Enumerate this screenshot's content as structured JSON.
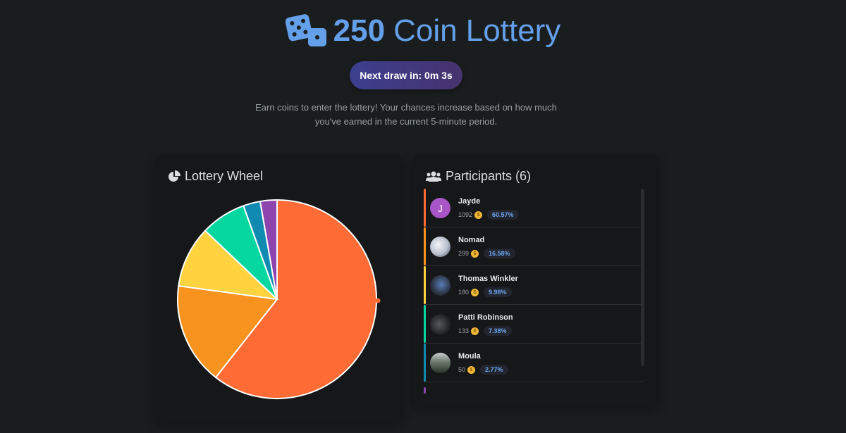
{
  "header": {
    "amount": "250",
    "title_rest": "Coin Lottery",
    "accent": "#64a0ea",
    "icon": "dice-icon"
  },
  "draw": {
    "label": "Next draw in: 0m 3s"
  },
  "description": "Earn coins to enter the lottery! Your chances increase based on how much you've earned in the current 5-minute period.",
  "wheel_panel": {
    "title": "Lottery Wheel",
    "icon": "pie-chart-icon"
  },
  "participants_panel": {
    "title": "Participants (6)",
    "icon": "users-icon"
  },
  "participants": [
    {
      "name": "Jayde",
      "coins": "1092",
      "percent": "60.57%",
      "color": "#ff6b35",
      "avatar_letter": "J",
      "avatar_color": "#a855c7"
    },
    {
      "name": "Nomad",
      "coins": "299",
      "percent": "16.58%",
      "color": "#f7931e",
      "avatar_letter": "",
      "avatar_color": "#d9dfe6"
    },
    {
      "name": "Thomas Winkler",
      "coins": "180",
      "percent": "9.98%",
      "color": "#ffd23f",
      "avatar_letter": "",
      "avatar_color": "#2b3342"
    },
    {
      "name": "Patti Robinson",
      "coins": "133",
      "percent": "7.38%",
      "color": "#06d6a0",
      "avatar_letter": "",
      "avatar_color": "#222426"
    },
    {
      "name": "Moula",
      "coins": "50",
      "percent": "2.77%",
      "color": "#118ab2",
      "avatar_letter": "",
      "avatar_color": "#3a4a3a"
    }
  ],
  "hidden_participant_color": "#8e44ad",
  "chart_data": {
    "type": "pie",
    "values": [
      60.57,
      16.58,
      9.98,
      7.38,
      2.77,
      2.72
    ],
    "colors": [
      "#ff6b35",
      "#f7931e",
      "#ffd23f",
      "#06d6a0",
      "#118ab2",
      "#8e44ad"
    ]
  }
}
